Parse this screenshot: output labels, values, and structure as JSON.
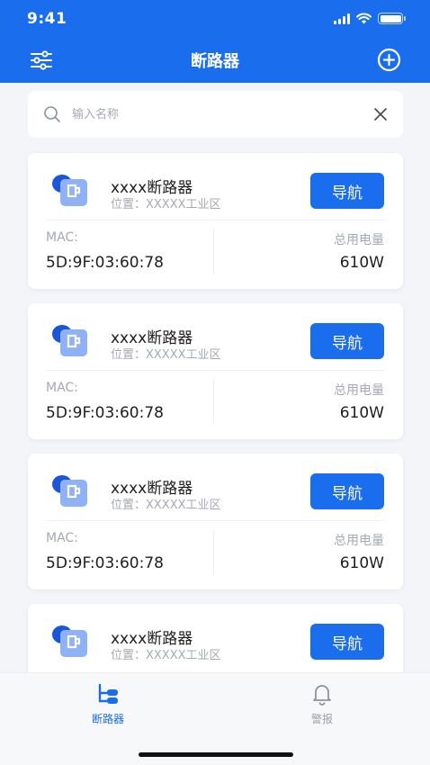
{
  "status_bar": {
    "time": "9:41"
  },
  "header": {
    "title": "断路器",
    "filter_icon": "filter-sliders-icon",
    "add_icon": "add-circle-icon"
  },
  "search": {
    "placeholder": "输入名称",
    "value": ""
  },
  "cards": [
    {
      "name": "xxxx断路器",
      "location": "位置：XXXXX工业区",
      "nav_label": "导航",
      "mac_label": "MAC:",
      "mac": "5D:9F:03:60:78",
      "power_label": "总用电量",
      "power": "610W"
    },
    {
      "name": "xxxx断路器",
      "location": "位置：XXXXX工业区",
      "nav_label": "导航",
      "mac_label": "MAC:",
      "mac": "5D:9F:03:60:78",
      "power_label": "总用电量",
      "power": "610W"
    },
    {
      "name": "xxxx断路器",
      "location": "位置：XXXXX工业区",
      "nav_label": "导航",
      "mac_label": "MAC:",
      "mac": "5D:9F:03:60:78",
      "power_label": "总用电量",
      "power": "610W"
    },
    {
      "name": "xxxx断路器",
      "location": "位置：XXXXX工业区",
      "nav_label": "导航"
    }
  ],
  "tabs": [
    {
      "label": "断路器",
      "icon": "breaker-tree-icon",
      "active": true
    },
    {
      "label": "警报",
      "icon": "bell-icon",
      "active": false
    }
  ],
  "colors": {
    "primary": "#1a6dec",
    "background": "#f3f5f9",
    "muted_text": "#a4a9b3",
    "text": "#1e1e1e"
  }
}
